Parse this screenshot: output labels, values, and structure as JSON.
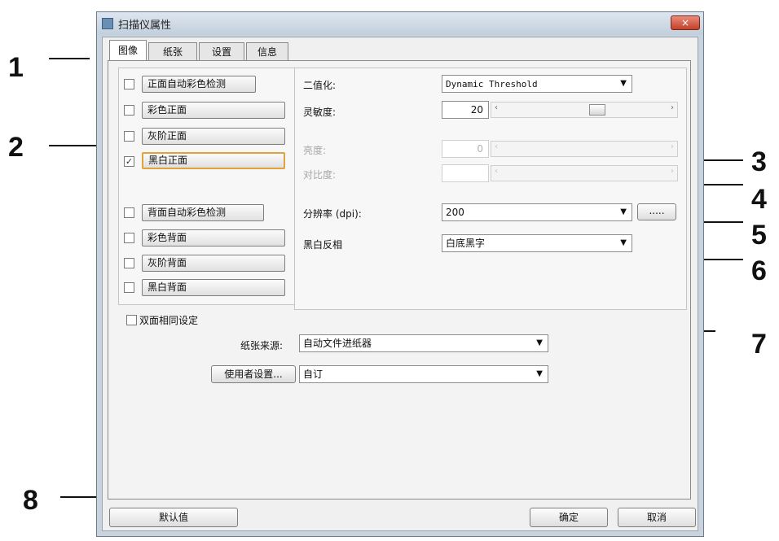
{
  "window": {
    "title": "扫描仪属性",
    "close_label": "×"
  },
  "tabs": [
    {
      "label": "图像"
    },
    {
      "label": "纸张"
    },
    {
      "label": "设置"
    },
    {
      "label": "信息"
    }
  ],
  "image_types": [
    {
      "label": "正面自动彩色检测",
      "checked": false
    },
    {
      "label": "彩色正面",
      "checked": false
    },
    {
      "label": "灰阶正面",
      "checked": false
    },
    {
      "label": "黑白正面",
      "checked": true
    },
    {
      "label": "背面自动彩色检测",
      "checked": false
    },
    {
      "label": "彩色背面",
      "checked": false
    },
    {
      "label": "灰阶背面",
      "checked": false
    },
    {
      "label": "黑白背面",
      "checked": false
    }
  ],
  "check_mark": "✓",
  "settings": {
    "binarization_label": "二值化:",
    "binarization_value": "Dynamic Threshold",
    "sensitivity_label": "灵敏度:",
    "sensitivity_value": "20",
    "sensitivity_level": 0.6,
    "brightness_label": "亮度:",
    "brightness_value": "0",
    "contrast_label": "对比度:",
    "resolution_label": "分辨率 (dpi):",
    "resolution_value": "200",
    "resolution_more": ".....",
    "invert_label": "黑白反相",
    "invert_value": "白底黑字"
  },
  "duplex": {
    "label": "双面相同设定",
    "checked": false
  },
  "paper_source": {
    "label": "纸张来源:",
    "value": "自动文件进纸器"
  },
  "user_settings": {
    "button_label": "使用者设置...",
    "value": "自订"
  },
  "buttons": {
    "default": "默认值",
    "ok": "确定",
    "cancel": "取消"
  },
  "callouts": [
    "1",
    "2",
    "3",
    "4",
    "5",
    "6",
    "7",
    "8"
  ],
  "arrow_glyph": "▼",
  "slider_left_glyph": "‹",
  "slider_right_glyph": "›"
}
